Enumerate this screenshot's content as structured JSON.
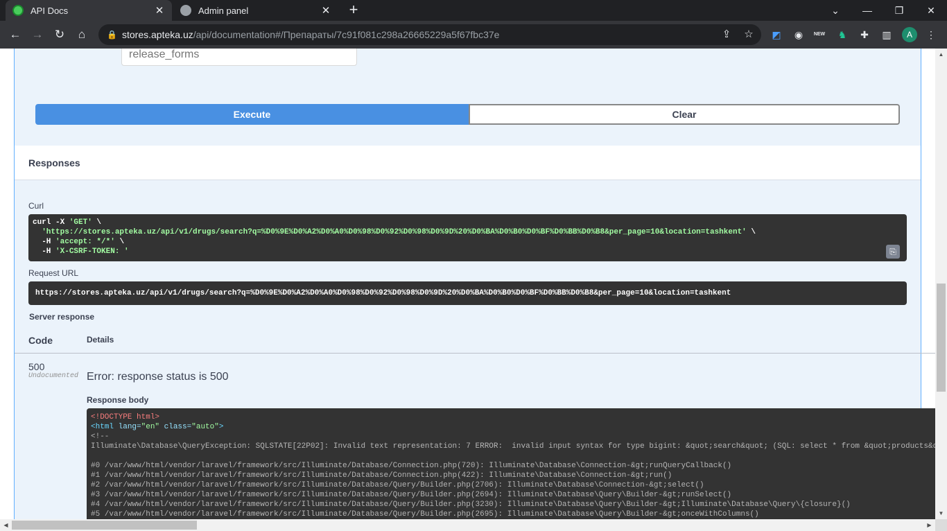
{
  "tabs": [
    {
      "title": "API Docs",
      "close": "✕"
    },
    {
      "title": "Admin panel",
      "close": "✕"
    }
  ],
  "window": {
    "newtab": "+",
    "dropdown": "⌄",
    "minimize": "—",
    "maximize": "❐",
    "close": "✕"
  },
  "address_bar": {
    "host": "stores.apteka.uz",
    "path": "/api/documentation#/Препараты/7c91f081c298a26665229a5f67fbc37e"
  },
  "profile": {
    "initial": "A"
  },
  "extensions": {
    "new_badge": "NEW"
  },
  "params": {
    "release_forms_placeholder": "release_forms"
  },
  "buttons": {
    "execute": "Execute",
    "clear": "Clear"
  },
  "responses": {
    "heading": "Responses",
    "curl_label": "Curl",
    "curl_lines": [
      {
        "pre": "curl -X ",
        "str": "'GET'",
        "post": " \\"
      },
      {
        "pre": "  ",
        "str": "'https://stores.apteka.uz/api/v1/drugs/search?q=%D0%9E%D0%A2%D0%A0%D0%98%D0%92%D0%98%D0%9D%20%D0%BA%D0%B0%D0%BF%D0%BB%D0%B8&per_page=10&location=tashkent'",
        "post": " \\"
      },
      {
        "pre": "  -H ",
        "str": "'accept: */*'",
        "post": " \\"
      },
      {
        "pre": "  -H ",
        "str": "'X-CSRF-TOKEN: '",
        "post": ""
      }
    ],
    "request_url_label": "Request URL",
    "request_url": "https://stores.apteka.uz/api/v1/drugs/search?q=%D0%9E%D0%A2%D0%A0%D0%98%D0%92%D0%98%D0%9D%20%D0%BA%D0%B0%D0%BF%D0%BB%D0%B8&per_page=10&location=tashkent",
    "server_response_label": "Server response",
    "columns": {
      "code": "Code",
      "details": "Details"
    },
    "status_code": "500",
    "status_note": "Undocumented",
    "error_message": "Error: response status is 500",
    "body_label": "Response body",
    "body": {
      "doctype": "<!DOCTYPE html>",
      "html_open": "<html",
      "lang_attr": " lang=",
      "lang_val": "\"en\"",
      "class_attr": " class=",
      "class_val": "\"auto\"",
      "html_close": ">",
      "comment": "<!--",
      "exception": "Illuminate\\Database\\QueryException: SQLSTATE[22P02]: Invalid text representation: 7 ERROR:  invalid input syntax for type bigint: &quot;search&quot; (SQL: select * from &quot;products&quot;",
      "trace": [
        "#0 /var/www/html/vendor/laravel/framework/src/Illuminate/Database/Connection.php(720): Illuminate\\Database\\Connection-&gt;runQueryCallback()",
        "#1 /var/www/html/vendor/laravel/framework/src/Illuminate/Database/Connection.php(422): Illuminate\\Database\\Connection-&gt;run()",
        "#2 /var/www/html/vendor/laravel/framework/src/Illuminate/Database/Query/Builder.php(2706): Illuminate\\Database\\Connection-&gt;select()",
        "#3 /var/www/html/vendor/laravel/framework/src/Illuminate/Database/Query/Builder.php(2694): Illuminate\\Database\\Query\\Builder-&gt;runSelect()",
        "#4 /var/www/html/vendor/laravel/framework/src/Illuminate/Database/Query/Builder.php(3230): Illuminate\\Database\\Query\\Builder-&gt;Illuminate\\Database\\Query\\{closure}()",
        "#5 /var/www/html/vendor/laravel/framework/src/Illuminate/Database/Query/Builder.php(2695): Illuminate\\Database\\Query\\Builder-&gt;onceWithColumns()"
      ]
    }
  },
  "colors": {
    "execute_bg": "#4990e2",
    "opblock_bg": "#ebf3fb",
    "code_bg": "#333333",
    "curl_string": "#a2fca2"
  }
}
